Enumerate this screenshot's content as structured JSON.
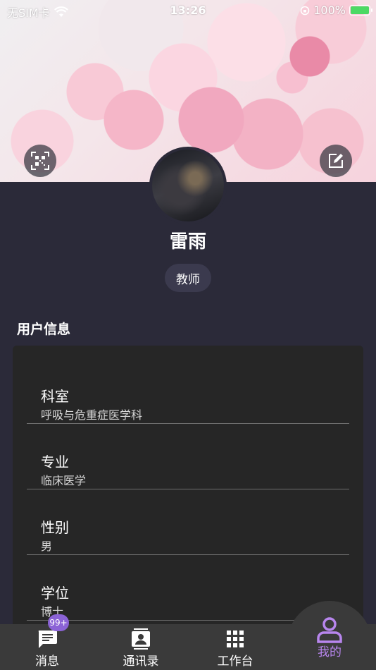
{
  "status_bar": {
    "carrier": "无SIM卡",
    "time": "13:26",
    "battery": "100%"
  },
  "profile": {
    "name": "雷雨",
    "role": "教师"
  },
  "section": {
    "title": "用户信息"
  },
  "info_items": [
    {
      "label": "科室",
      "value": "呼吸与危重症医学科"
    },
    {
      "label": "专业",
      "value": "临床医学"
    },
    {
      "label": "性别",
      "value": "男"
    },
    {
      "label": "学位",
      "value": "博士"
    }
  ],
  "tabs": [
    {
      "label": "消息",
      "icon": "message-icon"
    },
    {
      "label": "通讯录",
      "icon": "contacts-icon"
    },
    {
      "label": "工作台",
      "icon": "grid-icon"
    },
    {
      "label": "我的",
      "icon": "user-icon"
    }
  ],
  "badge": {
    "messages": "99+"
  },
  "colors": {
    "accent": "#b886ee",
    "background": "#2b2a39",
    "card": "#262626",
    "tabbar": "#3a3a3a"
  }
}
